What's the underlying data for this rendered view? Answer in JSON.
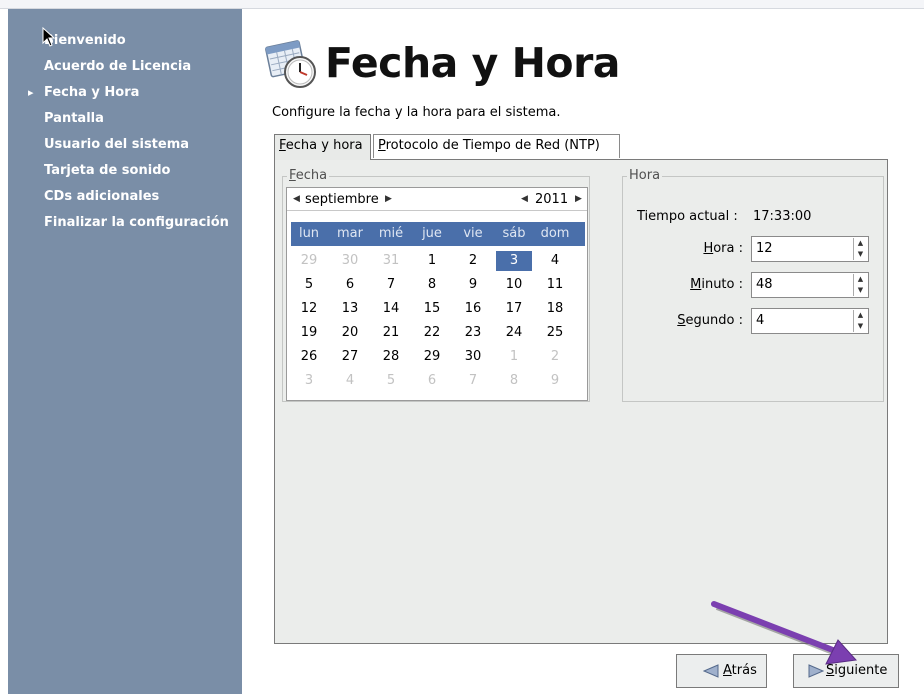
{
  "sidebar": {
    "items": [
      {
        "label": "Bienvenido",
        "current": false
      },
      {
        "label": "Acuerdo de Licencia",
        "current": false
      },
      {
        "label": "Fecha y Hora",
        "current": true
      },
      {
        "label": "Pantalla",
        "current": false
      },
      {
        "label": "Usuario del sistema",
        "current": false
      },
      {
        "label": "Tarjeta de sonido",
        "current": false
      },
      {
        "label": "CDs adicionales",
        "current": false
      },
      {
        "label": "Finalizar la configuración",
        "current": false
      }
    ]
  },
  "header": {
    "title": "Fecha y Hora",
    "description": "Configure la fecha y la hora para el sistema."
  },
  "tabs": {
    "active": {
      "mnemonic": "F",
      "rest": "echa y hora"
    },
    "ntp": {
      "mnemonic": "P",
      "rest": "rotocolo de Tiempo de Red (NTP)"
    }
  },
  "fecha": {
    "group_label": {
      "mnemonic": "F",
      "rest": "echa"
    },
    "month": "septiembre",
    "year": "2011",
    "weekdays": [
      "lun",
      "mar",
      "mié",
      "jue",
      "vie",
      "sáb",
      "dom"
    ],
    "weeks": [
      [
        "29",
        "30",
        "31",
        "1",
        "2",
        "3",
        "4"
      ],
      [
        "5",
        "6",
        "7",
        "8",
        "9",
        "10",
        "11"
      ],
      [
        "12",
        "13",
        "14",
        "15",
        "16",
        "17",
        "18"
      ],
      [
        "19",
        "20",
        "21",
        "22",
        "23",
        "24",
        "25"
      ],
      [
        "26",
        "27",
        "28",
        "29",
        "30",
        "1",
        "2"
      ],
      [
        "3",
        "4",
        "5",
        "6",
        "7",
        "8",
        "9"
      ]
    ],
    "selected_day": "3"
  },
  "hora": {
    "group_label": "Hora",
    "current_label": "Tiempo actual :",
    "current_value": "17:33:00",
    "hour_label": {
      "mnemonic": "H",
      "rest": "ora :"
    },
    "hour_value": "12",
    "minute_label": {
      "mnemonic": "M",
      "rest": "inuto :"
    },
    "minute_value": "48",
    "second_label": {
      "mnemonic": "S",
      "rest": "egundo :"
    },
    "second_value": "4"
  },
  "buttons": {
    "back": {
      "mnemonic": "A",
      "rest": "trás"
    },
    "next": {
      "mnemonic": "S",
      "rest": "iguiente"
    }
  },
  "colors": {
    "sidebar_bg": "#7a8ea7",
    "calendar_header": "#4a6faa",
    "annotation_arrow": "#7b3fb0"
  },
  "icons": {
    "title_icon": "calendar-clock-icon",
    "sidebar_marker": "triangle-right-icon",
    "annotation": "purple-arrow"
  }
}
